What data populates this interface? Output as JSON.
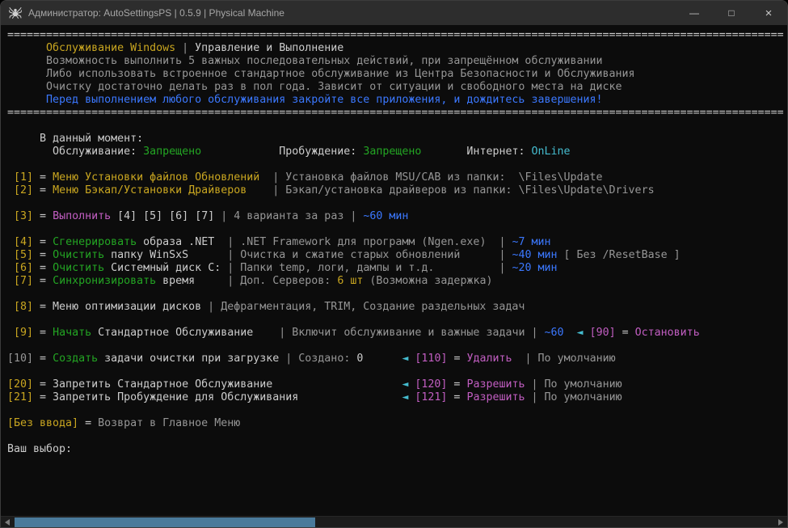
{
  "window": {
    "title": "Администратор: AutoSettingsPS | 0.5.9 | Physical Machine",
    "controls": {
      "minimize": "—",
      "maximize": "□",
      "close": "×"
    }
  },
  "icons": {
    "app": "spider",
    "scroll_left": "left-arrow",
    "scroll_right": "right-arrow"
  },
  "palette": {
    "background": "#0C0C0C",
    "titlebar": "#2D2D2D",
    "fg": "#CCCCCC",
    "dim": "#969696",
    "yel": "#C9A620",
    "grn": "#23A523",
    "blu": "#3B78FF",
    "cyn": "#45BCCF",
    "mag": "#C25EC2",
    "scrollbar_thumb": "#4A7A9B"
  },
  "console": {
    "prompt": "Ваш выбор:",
    "lines": [
      [
        [
          "fg",
          "========================================================================================================================"
        ]
      ],
      [
        [
          "yel",
          "      Обслуживание Windows"
        ],
        [
          "dim",
          " | "
        ],
        [
          "fg",
          "Управление и Выполнение"
        ]
      ],
      [
        [
          "dim",
          "      Возможность выполнить 5 важных последовательных действий, при запрещённом обслуживании"
        ]
      ],
      [
        [
          "dim",
          "      Либо использовать встроенное стандартное обслуживание из Центра Безопасности и Обслуживания"
        ]
      ],
      [
        [
          "dim",
          "      Очистку достаточно делать раз в пол года. Зависит от ситуации и свободного места на диске"
        ]
      ],
      [
        [
          "blu",
          "      Перед выполнением любого обслуживания закройте все приложения, и дождитесь завершения!"
        ]
      ],
      [
        [
          "fg",
          "========================================================================================================================"
        ]
      ],
      [],
      [
        [
          "fg",
          "     В данный момент:"
        ]
      ],
      [
        [
          "fg",
          "       Обслуживание: "
        ],
        [
          "grn",
          "Запрещено"
        ],
        [
          "fg",
          "            Пробуждение: "
        ],
        [
          "grn",
          "Запрещено"
        ],
        [
          "fg",
          "       Интернет: "
        ],
        [
          "cyn",
          "OnLine"
        ]
      ],
      [],
      [
        [
          "yel",
          " [1]"
        ],
        [
          "fg",
          " = "
        ],
        [
          "yel",
          "Меню Установки файлов Обновлений"
        ],
        [
          "dim",
          "  | Установка файлов MSU/CAB из папки:  \\Files\\Update"
        ]
      ],
      [
        [
          "yel",
          " [2]"
        ],
        [
          "fg",
          " = "
        ],
        [
          "yel",
          "Меню Бэкап/Установки Драйверов"
        ],
        [
          "dim",
          "    | Бэкап/установка драйверов из папки: \\Files\\Update\\Drivers"
        ]
      ],
      [],
      [
        [
          "yel",
          " [3]"
        ],
        [
          "fg",
          " = "
        ],
        [
          "mag",
          "Выполнить"
        ],
        [
          "fg",
          " [4] [5] [6] [7]"
        ],
        [
          "dim",
          " | 4 варианта за раз | "
        ],
        [
          "blu",
          "~60 мин"
        ]
      ],
      [],
      [
        [
          "yel",
          " [4]"
        ],
        [
          "fg",
          " = "
        ],
        [
          "grn",
          "Сгенерировать"
        ],
        [
          "fg",
          " образа .NET"
        ],
        [
          "dim",
          "  | .NET Framework для программ (Ngen.exe)  | "
        ],
        [
          "blu",
          "~7 мин"
        ]
      ],
      [
        [
          "yel",
          " [5]"
        ],
        [
          "fg",
          " = "
        ],
        [
          "grn",
          "Очистить"
        ],
        [
          "fg",
          " папку WinSxS"
        ],
        [
          "dim",
          "      | Очистка и сжатие старых обновлений      | "
        ],
        [
          "blu",
          "~40 мин"
        ],
        [
          "dim",
          " [ Без /ResetBase ]"
        ]
      ],
      [
        [
          "yel",
          " [6]"
        ],
        [
          "fg",
          " = "
        ],
        [
          "grn",
          "Очистить"
        ],
        [
          "fg",
          " Системный диск C:"
        ],
        [
          "dim",
          " | Папки temp, логи, дампы и т.д.          | "
        ],
        [
          "blu",
          "~20 мин"
        ]
      ],
      [
        [
          "yel",
          " [7]"
        ],
        [
          "fg",
          " = "
        ],
        [
          "grn",
          "Синхронизировать"
        ],
        [
          "fg",
          " время"
        ],
        [
          "dim",
          "     | Доп. Серверов: "
        ],
        [
          "yel",
          "6 шт"
        ],
        [
          "dim",
          " (Возможна задержка)"
        ]
      ],
      [],
      [
        [
          "yel",
          " [8]"
        ],
        [
          "fg",
          " = Меню оптимизации дисков"
        ],
        [
          "dim",
          " | Дефрагментация, TRIM, Создание раздельных задач"
        ]
      ],
      [],
      [
        [
          "yel",
          " [9]"
        ],
        [
          "fg",
          " = "
        ],
        [
          "grn",
          "Начать"
        ],
        [
          "fg",
          " Стандартное Обслуживание"
        ],
        [
          "dim",
          "    | Включит обслуживание и важные задачи | "
        ],
        [
          "blu",
          "~60"
        ],
        [
          "fg",
          "  "
        ],
        [
          "cyn",
          "◄"
        ],
        [
          "fg",
          " "
        ],
        [
          "mag",
          "[90]"
        ],
        [
          "fg",
          " = "
        ],
        [
          "mag",
          "Остановить"
        ]
      ],
      [],
      [
        [
          "dim",
          "[10]"
        ],
        [
          "fg",
          " = "
        ],
        [
          "grn",
          "Создать"
        ],
        [
          "fg",
          " задачи очистки при загрузке"
        ],
        [
          "dim",
          " | Создано: "
        ],
        [
          "fg",
          "0      "
        ],
        [
          "cyn",
          "◄"
        ],
        [
          "fg",
          " "
        ],
        [
          "mag",
          "[110]"
        ],
        [
          "fg",
          " = "
        ],
        [
          "mag",
          "Удалить"
        ],
        [
          "dim",
          "  | По умолчанию"
        ]
      ],
      [],
      [
        [
          "yel",
          "[20]"
        ],
        [
          "fg",
          " = Запретить Стандартное Обслуживание                    "
        ],
        [
          "cyn",
          "◄"
        ],
        [
          "fg",
          " "
        ],
        [
          "mag",
          "[120]"
        ],
        [
          "fg",
          " = "
        ],
        [
          "mag",
          "Разрешить"
        ],
        [
          "dim",
          " | По умолчанию"
        ]
      ],
      [
        [
          "yel",
          "[21]"
        ],
        [
          "fg",
          " = Запретить Пробуждение для Обслуживания                "
        ],
        [
          "cyn",
          "◄"
        ],
        [
          "fg",
          " "
        ],
        [
          "mag",
          "[121]"
        ],
        [
          "fg",
          " = "
        ],
        [
          "mag",
          "Разрешить"
        ],
        [
          "dim",
          " | По умолчанию"
        ]
      ],
      [],
      [
        [
          "yel",
          "[Без ввода]"
        ],
        [
          "fg",
          " = "
        ],
        [
          "dim",
          "Возврат в Главное Меню"
        ]
      ],
      [],
      [
        [
          "fg",
          "Ваш выбор:"
        ]
      ]
    ]
  }
}
